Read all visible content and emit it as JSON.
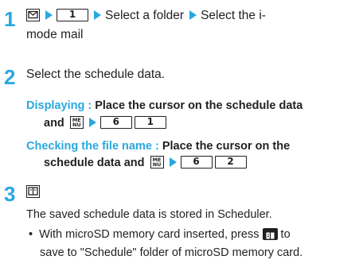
{
  "steps": [
    {
      "number": "1",
      "key_mail_icon": "mail-envelope-key-icon",
      "key_1": "1",
      "text_folder": "Select a folder",
      "text_mail_line1": "Select the i-",
      "text_mail_line2": "mode mail"
    },
    {
      "number": "2",
      "text": "Select the schedule data.",
      "sub1": {
        "label": "Displaying :",
        "text_line1": "Place the cursor on the schedule data",
        "text_line2": "and",
        "key_menu_top": "ME",
        "key_menu_bottom": "NU",
        "key_a": "6",
        "key_b": "1"
      },
      "sub2": {
        "label": "Checking the file name :",
        "text_line1": "Place the cursor on the",
        "text_line2": "schedule data and",
        "key_menu_top": "ME",
        "key_menu_bottom": "NU",
        "key_a": "6",
        "key_b": "2"
      }
    },
    {
      "number": "3",
      "key_icon": "book-key-icon",
      "text": "The saved schedule data is stored in Scheduler.",
      "bullet_line1_before": "With microSD memory card inserted, press",
      "bullet_line1_after": "to",
      "bullet_line2": "save to \"Schedule\" folder of microSD memory card."
    }
  ],
  "colors": {
    "accent": "#29a8e0",
    "text": "#231f20"
  }
}
